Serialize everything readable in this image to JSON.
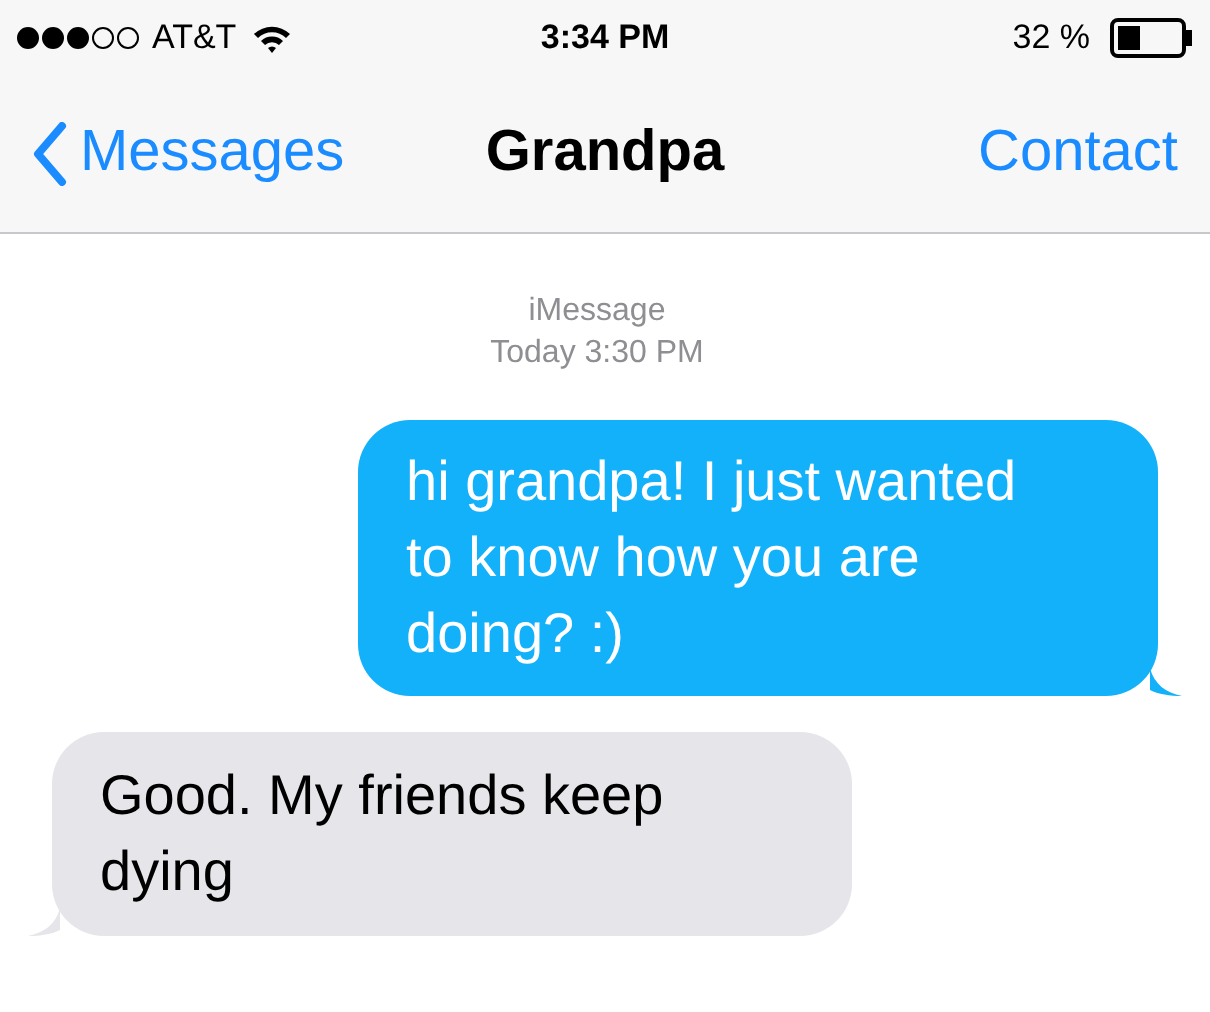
{
  "status_bar": {
    "carrier": "AT&T",
    "time": "3:34 PM",
    "battery": "32 %"
  },
  "nav": {
    "back": "Messages",
    "title": "Grandpa",
    "action": "Contact"
  },
  "thread": {
    "service": "iMessage",
    "timestamp": "Today 3:30 PM"
  },
  "messages": [
    {
      "kind": "outgoing",
      "text": "hi grandpa! I just wanted to know how you are doing? :)"
    },
    {
      "kind": "incoming",
      "text": "Good. My friends keep dying"
    }
  ]
}
